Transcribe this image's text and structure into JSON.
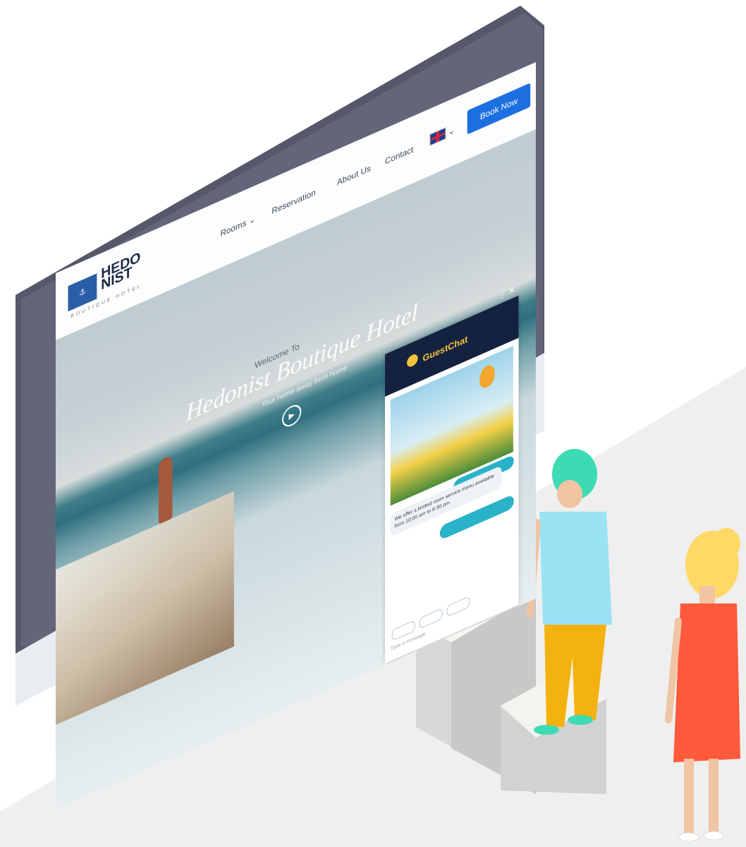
{
  "site": {
    "logo_line1": "HEDO",
    "logo_line2": "NIST",
    "logo_sub": "BOUTIQUE HOTEL",
    "nav": [
      "Rooms",
      "Reservation",
      "About Us",
      "Contact"
    ],
    "book_now": "Book Now",
    "welcome": "Welcome To",
    "hero_title": "Hedonist Boutique Hotel",
    "tagline": "Your home away from home"
  },
  "chat": {
    "brand": "GuestChat",
    "bot_message": "We offer a limited room service menu available from 10:00 am to 9:30 pm.",
    "input_placeholder": "Type a message"
  },
  "colors": {
    "accent": "#1c6fe0",
    "chat_header": "#14223f",
    "chat_brand": "#f4c23d",
    "chat_quick": "#2ab3c8",
    "monitor_frame": "#55586a",
    "floor": "#efefef"
  }
}
